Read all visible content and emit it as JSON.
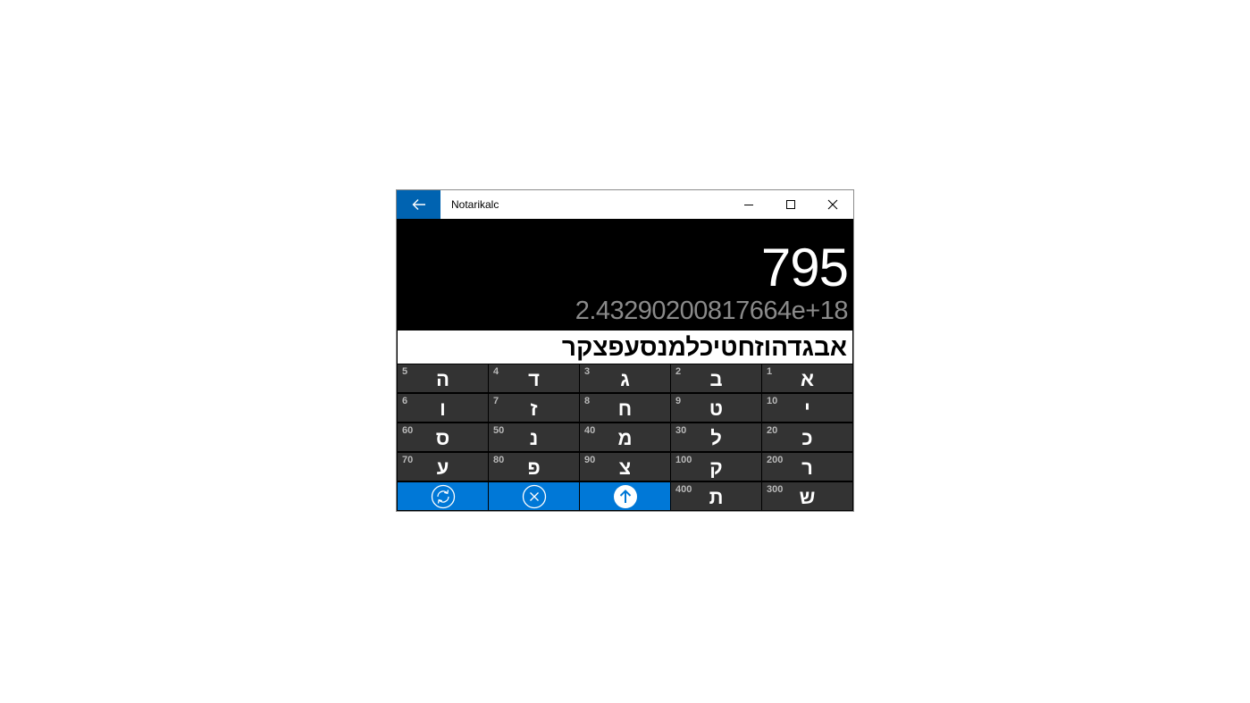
{
  "window": {
    "title": "Notarikalc",
    "back_icon": "arrow-left-icon",
    "controls": [
      "minimize-icon",
      "maximize-icon",
      "close-icon"
    ]
  },
  "display": {
    "result": "795",
    "secondary": "2.43290200817664e+18"
  },
  "input": {
    "text": "אבגדהוזחטיכלמנסעפצקר"
  },
  "keys": [
    {
      "value": "1",
      "letter": "א"
    },
    {
      "value": "2",
      "letter": "ב"
    },
    {
      "value": "3",
      "letter": "ג"
    },
    {
      "value": "4",
      "letter": "ד"
    },
    {
      "value": "5",
      "letter": "ה"
    },
    {
      "value": "10",
      "letter": "י"
    },
    {
      "value": "9",
      "letter": "ט"
    },
    {
      "value": "8",
      "letter": "ח"
    },
    {
      "value": "7",
      "letter": "ז"
    },
    {
      "value": "6",
      "letter": "ו"
    },
    {
      "value": "20",
      "letter": "כ"
    },
    {
      "value": "30",
      "letter": "ל"
    },
    {
      "value": "40",
      "letter": "מ"
    },
    {
      "value": "50",
      "letter": "נ"
    },
    {
      "value": "60",
      "letter": "ס"
    },
    {
      "value": "200",
      "letter": "ר"
    },
    {
      "value": "100",
      "letter": "ק"
    },
    {
      "value": "90",
      "letter": "צ"
    },
    {
      "value": "80",
      "letter": "פ"
    },
    {
      "value": "70",
      "letter": "ע"
    },
    {
      "value": "300",
      "letter": "ש"
    },
    {
      "value": "400",
      "letter": "ת"
    }
  ],
  "actions": [
    {
      "icon": "refresh-icon"
    },
    {
      "icon": "clear-icon"
    },
    {
      "icon": "arrow-up-icon"
    }
  ],
  "colors": {
    "accent": "#0078d7",
    "back_button": "#0063b1",
    "key_bg": "#333333",
    "display_bg": "#000000"
  }
}
